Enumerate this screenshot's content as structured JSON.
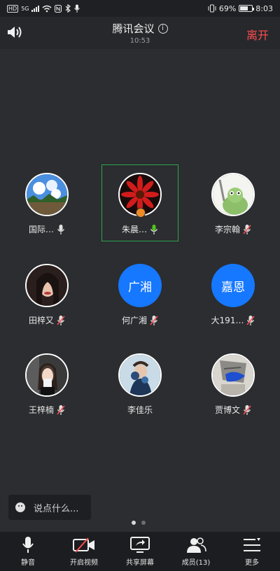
{
  "status_bar": {
    "left_indicators": [
      "HD",
      "5G"
    ],
    "battery_text": "69%",
    "battery_level": 0.69,
    "time": "8:03"
  },
  "header": {
    "title": "腾讯会议",
    "duration": "10:53",
    "leave_label": "离开"
  },
  "participants": [
    {
      "name": "国际…",
      "mic": "on",
      "avatar": "photo-sky",
      "active": false
    },
    {
      "name": "朱晨…",
      "mic": "speaking",
      "avatar": "photo-red-flower",
      "active": true,
      "host": true
    },
    {
      "name": "李宗翰",
      "mic": "muted",
      "avatar": "photo-frog",
      "active": false
    },
    {
      "name": "田梓又",
      "mic": "muted",
      "avatar": "photo-portrait",
      "active": false
    },
    {
      "name": "何广湘",
      "mic": "muted",
      "avatar_text": "广湘",
      "active": false
    },
    {
      "name": "大191…",
      "mic": "muted",
      "avatar_text": "嘉恩",
      "active": false
    },
    {
      "name": "王梓楠",
      "mic": "muted",
      "avatar": "photo-selfie",
      "active": false
    },
    {
      "name": "李佳乐",
      "mic": "none",
      "avatar": "photo-flowers",
      "active": false
    },
    {
      "name": "贾博文",
      "mic": "muted",
      "avatar": "photo-sketch",
      "active": false
    }
  ],
  "chat": {
    "placeholder": "说点什么..."
  },
  "pager": {
    "pages": 2,
    "current": 1
  },
  "toolbar": {
    "mute_label": "静音",
    "video_label": "开启视频",
    "share_label": "共享屏幕",
    "members_label": "成员(13)",
    "more_label": "更多"
  },
  "colors": {
    "background": "#2b2d30",
    "leave": "#ff4d4f",
    "active_border": "#2ea44f",
    "text_avatar": "#1677ff",
    "mic_speaking": "#52c41a",
    "mic_muted": "#ff4d4f"
  }
}
